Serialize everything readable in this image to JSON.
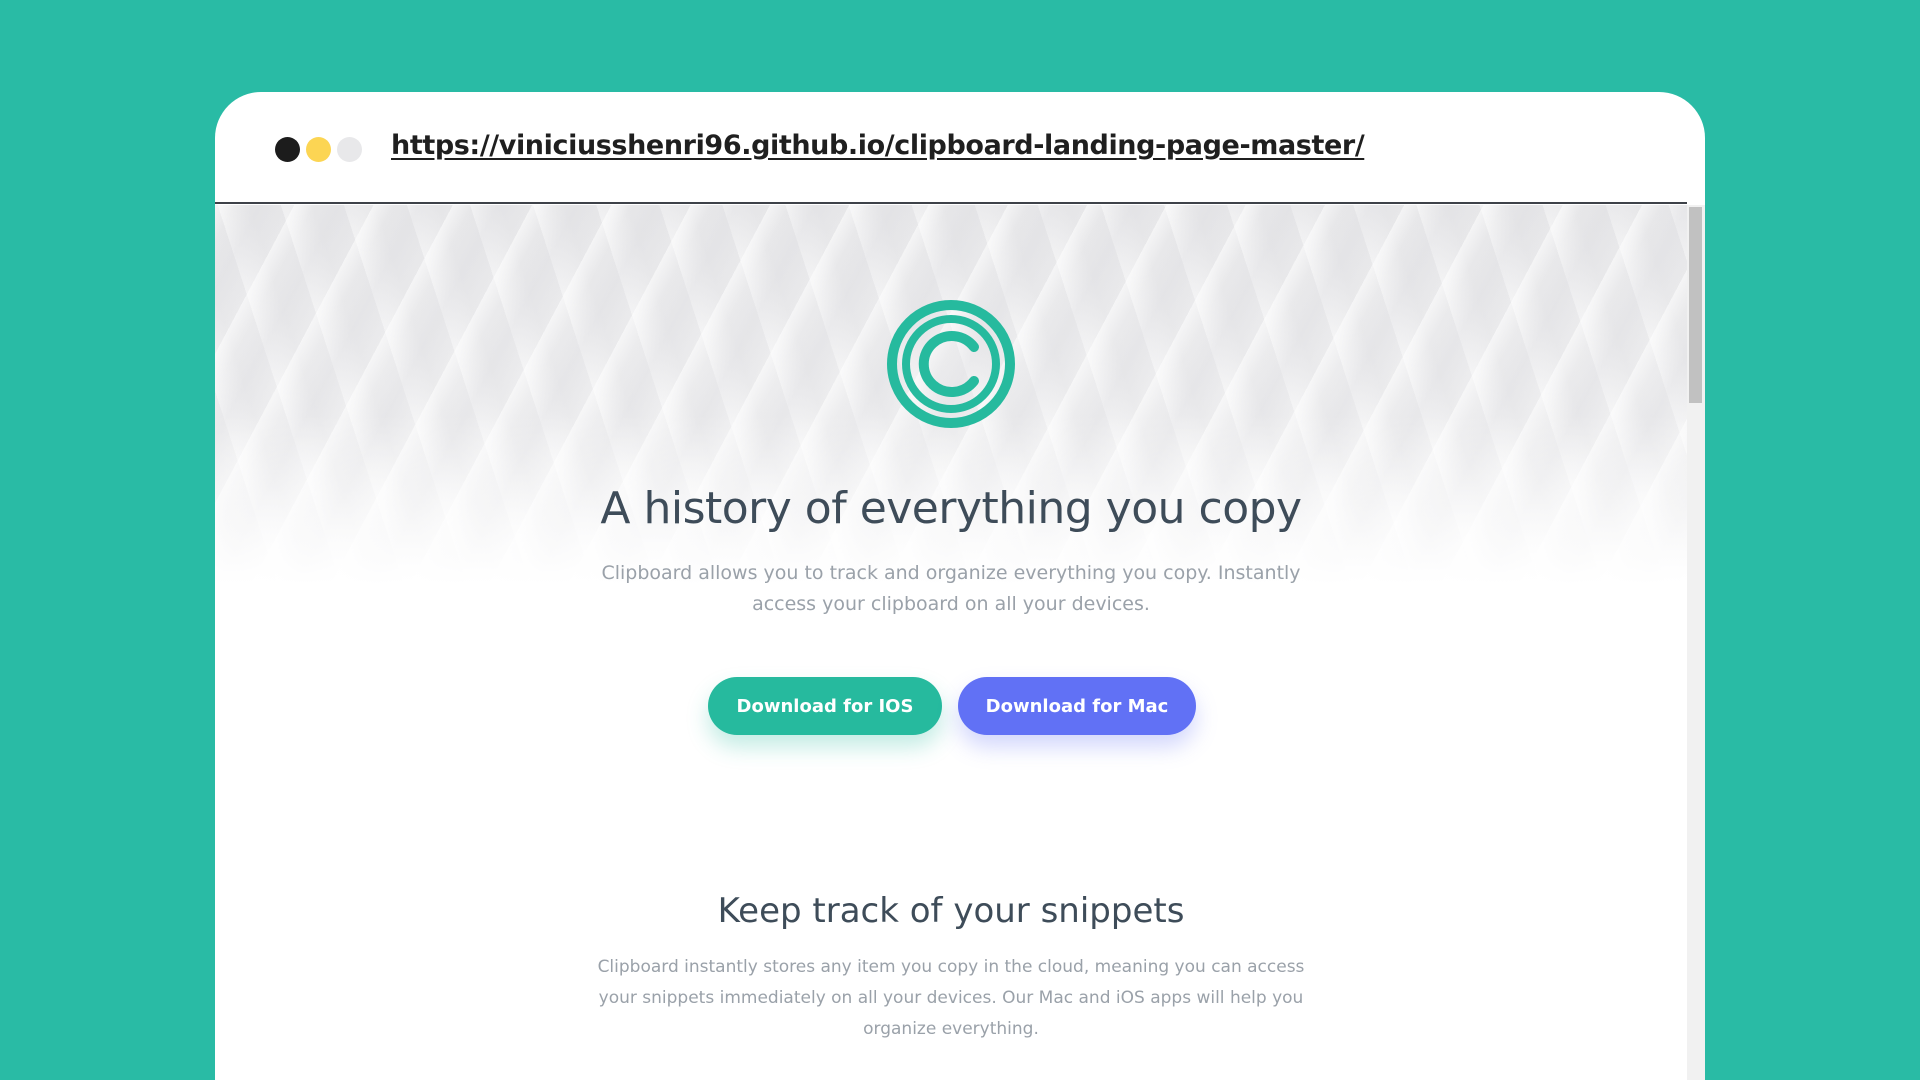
{
  "browser": {
    "url": "https://viniciusshenri96.github.io/clipboard-landing-page-master/"
  },
  "hero": {
    "logo_icon": "clipboard-copyright-logo-icon",
    "title": "A history of everything you copy",
    "description": "Clipboard allows you to track and organize everything you copy. Instantly access your clipboard on all your devices.",
    "buttons": {
      "ios_label": "Download for IOS",
      "mac_label": "Download for Mac"
    }
  },
  "snippets_section": {
    "title": "Keep track of your snippets",
    "description": "Clipboard instantly stores any item you copy in the cloud, meaning you can access your snippets immediately on all your devices. Our Mac and iOS apps will help you organize everything."
  },
  "colors": {
    "background": "#29bba5",
    "accent_teal": "#26ba9e",
    "accent_blue": "#6171f5",
    "heading": "#3e4c59",
    "body_text": "#9aa1a9"
  }
}
